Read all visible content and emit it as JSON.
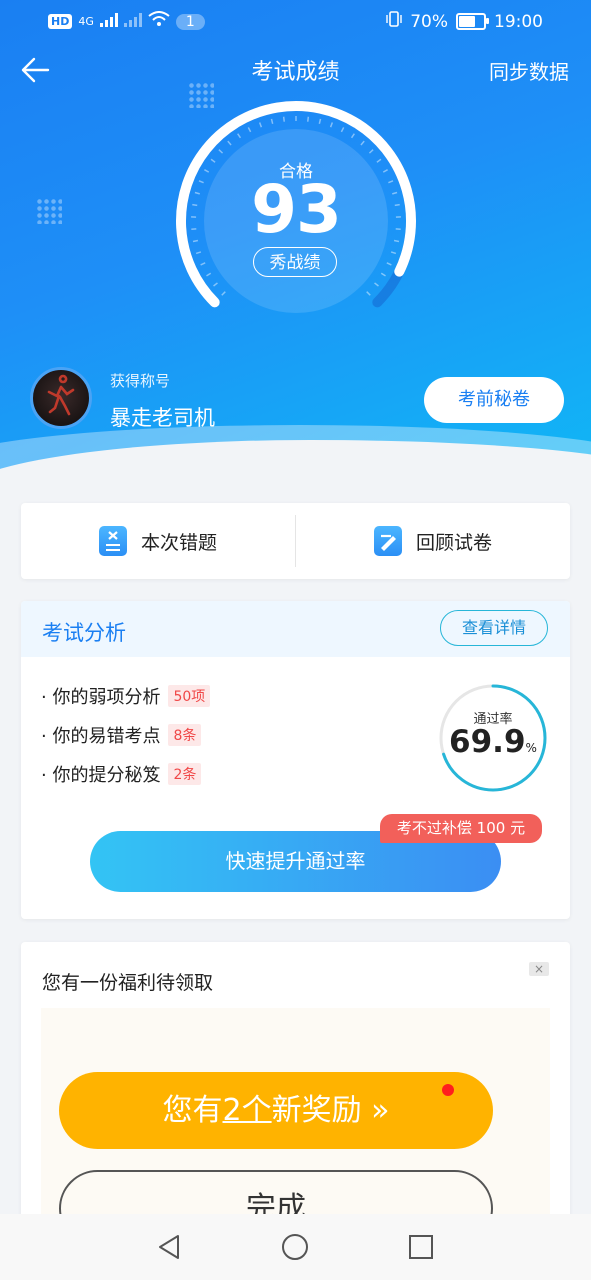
{
  "status_bar": {
    "left_chip": "HD",
    "network": "4G",
    "notif_count": "1",
    "battery": "70%",
    "time": "19:00"
  },
  "header": {
    "title": "考试成绩",
    "sync_label": "同步数据"
  },
  "score": {
    "label": "合格",
    "value": "93",
    "show_label": "秀战绩",
    "gauge_fraction": 0.93
  },
  "user": {
    "title_label": "获得称号",
    "title_name": "暴走老司机",
    "secret_btn": "考前秘卷"
  },
  "quick_actions": [
    {
      "label": "本次错题",
      "icon": "wrong-questions-icon"
    },
    {
      "label": "回顾试卷",
      "icon": "review-paper-icon"
    }
  ],
  "analysis": {
    "title": "考试分析",
    "detail_btn": "查看详情",
    "rows": [
      {
        "label": "· 你的弱项分析",
        "tag": "50项"
      },
      {
        "label": "· 你的易错考点",
        "tag": "8条"
      },
      {
        "label": "· 你的提分秘笈",
        "tag": "2条"
      }
    ],
    "pass_label": "通过率",
    "pass_value": "69.9",
    "pass_unit": "%",
    "boost_btn": "快速提升通过率",
    "compensation_tag": "考不过补偿 100 元"
  },
  "welfare": {
    "title": "您有一份福利待领取",
    "close": "×",
    "reward_prefix": "您有",
    "reward_count": "2个",
    "reward_suffix": "新奖励 »",
    "done_btn": "完成"
  },
  "colors": {
    "primary": "#1a7ff2",
    "accent_cyan": "#27b6d8",
    "reward": "#ffb300",
    "tag_red": "#f04848"
  }
}
